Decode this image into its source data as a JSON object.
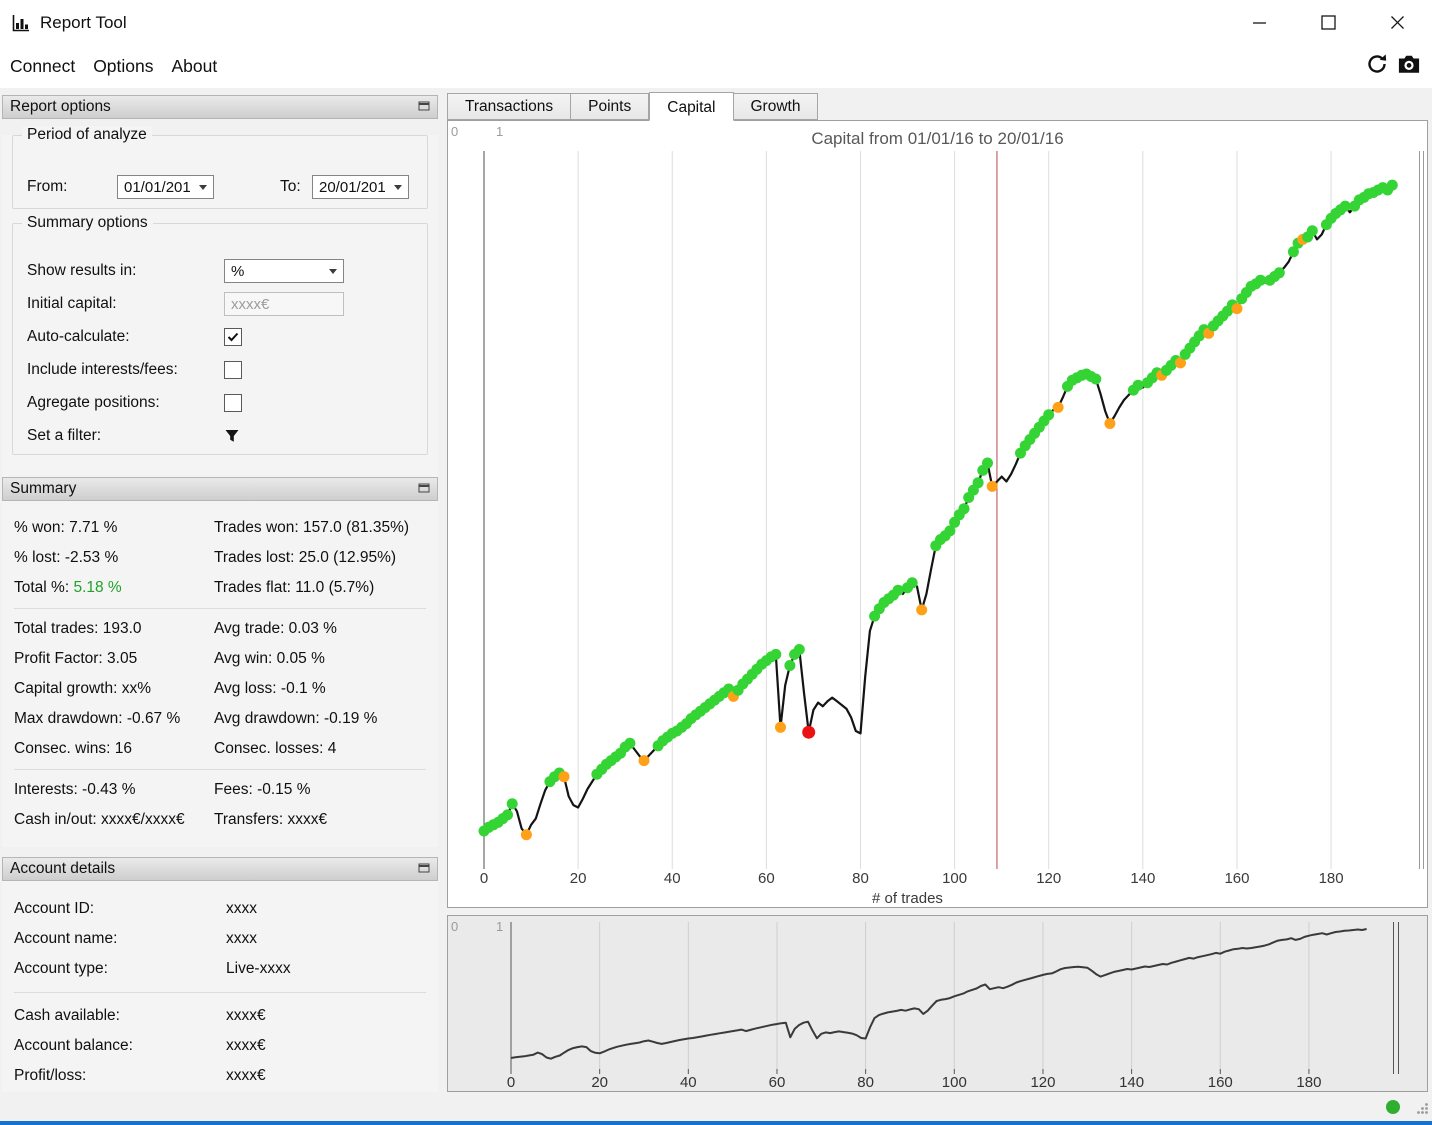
{
  "window": {
    "title": "Report Tool"
  },
  "menu": {
    "items": [
      "Connect",
      "Options",
      "About"
    ]
  },
  "report_options": {
    "header": "Report options",
    "period": {
      "title": "Period of analyze",
      "from_label": "From:",
      "from_value": "01/01/201",
      "to_label": "To:",
      "to_value": "20/01/201"
    },
    "options": {
      "title": "Summary options",
      "show_results_label": "Show results in:",
      "show_results_value": "%",
      "initial_capital_label": "Initial capital:",
      "initial_capital_value": "xxxx€",
      "auto_calculate_label": "Auto-calculate:",
      "auto_calculate_checked": true,
      "include_fees_label": "Include interests/fees:",
      "include_fees_checked": false,
      "aggregate_label": "Agregate positions:",
      "aggregate_checked": false,
      "filter_label": "Set a filter:"
    }
  },
  "summary": {
    "header": "Summary",
    "rows1": [
      {
        "l": "% won: 7.71 %",
        "r": "Trades won: 157.0 (81.35%)"
      },
      {
        "l": "% lost: -2.53 %",
        "r": "Trades lost: 25.0 (12.95%)"
      }
    ],
    "total": {
      "label": "Total %:",
      "value": "5.18 %",
      "right": "Trades flat: 11.0 (5.7%)"
    },
    "total_color": "#1fa32a",
    "rows2": [
      {
        "l": "Total trades: 193.0",
        "r": "Avg trade: 0.03 %"
      },
      {
        "l": "Profit Factor: 3.05",
        "r": "Avg win: 0.05 %"
      },
      {
        "l": "Capital growth: xx%",
        "r": "Avg loss: -0.1 %"
      },
      {
        "l": "Max drawdown: -0.67 %",
        "r": "Avg drawdown: -0.19 %"
      },
      {
        "l": "Consec. wins: 16",
        "r": "Consec. losses: 4"
      }
    ],
    "rows3": [
      {
        "l": "Interests: -0.43 %",
        "r": "Fees: -0.15 %"
      },
      {
        "l": "Cash in/out: xxxx€/xxxx€",
        "r": "Transfers: xxxx€"
      }
    ]
  },
  "account": {
    "header": "Account details",
    "rows1": [
      {
        "l": "Account ID:",
        "v": "xxxx"
      },
      {
        "l": "Account name:",
        "v": "xxxx"
      },
      {
        "l": "Account type:",
        "v": "Live-xxxx"
      }
    ],
    "rows2": [
      {
        "l": "Cash available:",
        "v": "xxxx€"
      },
      {
        "l": "Account balance:",
        "v": "xxxx€"
      },
      {
        "l": "Profit/loss:",
        "v": "xxxx€"
      }
    ]
  },
  "tabs": [
    {
      "label": "Transactions",
      "active": false
    },
    {
      "label": "Points",
      "active": false
    },
    {
      "label": "Capital",
      "active": true
    },
    {
      "label": "Growth",
      "active": false
    }
  ],
  "chart_data": {
    "type": "line",
    "title": "Capital from 01/01/16 to 20/01/16",
    "xlabel": "# of trades",
    "x_ticks": [
      0,
      20,
      40,
      60,
      80,
      100,
      120,
      140,
      160,
      180
    ],
    "xlim": [
      -8,
      200
    ],
    "ylim_pct": [
      -0.4,
      5.6
    ],
    "grid": "vertical",
    "axis_fragments": [
      "0",
      "1"
    ],
    "line_color": "#141414",
    "marker_colors": {
      "g": "#35d435",
      "o": "#ffa019",
      "r": "#ea1212"
    },
    "vline_x": 109,
    "vline_color": "#b5494c",
    "series": [
      {
        "name": "Capital (%)",
        "points": [
          [
            0,
            0.0,
            "g"
          ],
          [
            1,
            0.03,
            "g"
          ],
          [
            2,
            0.05,
            "g"
          ],
          [
            3,
            0.07,
            "g"
          ],
          [
            4,
            0.1,
            "g"
          ],
          [
            5,
            0.13,
            "g"
          ],
          [
            6,
            0.22,
            "g"
          ],
          [
            7,
            0.16,
            ""
          ],
          [
            8,
            0.02,
            ""
          ],
          [
            9,
            -0.03,
            "o"
          ],
          [
            10,
            0.05,
            ""
          ],
          [
            11,
            0.1,
            ""
          ],
          [
            12,
            0.22,
            ""
          ],
          [
            13,
            0.33,
            ""
          ],
          [
            14,
            0.4,
            "g"
          ],
          [
            15,
            0.44,
            "g"
          ],
          [
            16,
            0.47,
            "g"
          ],
          [
            17,
            0.44,
            "o"
          ],
          [
            18,
            0.28,
            ""
          ],
          [
            19,
            0.21,
            ""
          ],
          [
            20,
            0.19,
            ""
          ],
          [
            21,
            0.26,
            ""
          ],
          [
            22,
            0.34,
            ""
          ],
          [
            23,
            0.4,
            ""
          ],
          [
            24,
            0.46,
            "g"
          ],
          [
            25,
            0.5,
            "g"
          ],
          [
            26,
            0.54,
            "g"
          ],
          [
            27,
            0.57,
            "g"
          ],
          [
            28,
            0.6,
            "g"
          ],
          [
            29,
            0.63,
            "g"
          ],
          [
            30,
            0.68,
            "g"
          ],
          [
            31,
            0.71,
            "g"
          ],
          [
            32,
            0.66,
            ""
          ],
          [
            33,
            0.61,
            ""
          ],
          [
            34,
            0.57,
            "o"
          ],
          [
            35,
            0.61,
            ""
          ],
          [
            36,
            0.65,
            ""
          ],
          [
            37,
            0.69,
            "g"
          ],
          [
            38,
            0.73,
            "g"
          ],
          [
            39,
            0.76,
            "g"
          ],
          [
            40,
            0.79,
            "g"
          ],
          [
            41,
            0.81,
            "g"
          ],
          [
            42,
            0.84,
            "g"
          ],
          [
            43,
            0.87,
            "g"
          ],
          [
            44,
            0.91,
            "g"
          ],
          [
            45,
            0.94,
            "g"
          ],
          [
            46,
            0.97,
            "g"
          ],
          [
            47,
            1.0,
            "g"
          ],
          [
            48,
            1.03,
            "g"
          ],
          [
            49,
            1.06,
            "g"
          ],
          [
            50,
            1.09,
            "g"
          ],
          [
            51,
            1.12,
            "g"
          ],
          [
            52,
            1.15,
            "g"
          ],
          [
            53,
            1.09,
            "o"
          ],
          [
            54,
            1.14,
            "g"
          ],
          [
            55,
            1.19,
            "g"
          ],
          [
            56,
            1.23,
            "g"
          ],
          [
            57,
            1.27,
            "g"
          ],
          [
            58,
            1.31,
            "g"
          ],
          [
            59,
            1.35,
            "g"
          ],
          [
            60,
            1.38,
            "g"
          ],
          [
            61,
            1.41,
            "g"
          ],
          [
            62,
            1.43,
            "g"
          ],
          [
            63,
            0.84,
            "o"
          ],
          [
            64,
            1.18,
            ""
          ],
          [
            65,
            1.34,
            "g"
          ],
          [
            66,
            1.43,
            "g"
          ],
          [
            67,
            1.47,
            "g"
          ],
          [
            68,
            1.12,
            ""
          ],
          [
            69,
            0.8,
            "r"
          ],
          [
            70,
            0.98,
            ""
          ],
          [
            71,
            1.04,
            ""
          ],
          [
            72,
            1.01,
            ""
          ],
          [
            73,
            1.05,
            ""
          ],
          [
            74,
            1.08,
            ""
          ],
          [
            75,
            1.05,
            ""
          ],
          [
            76,
            1.02,
            ""
          ],
          [
            77,
            0.99,
            ""
          ],
          [
            78,
            0.92,
            ""
          ],
          [
            79,
            0.81,
            ""
          ],
          [
            80,
            0.79,
            ""
          ],
          [
            81,
            1.25,
            ""
          ],
          [
            82,
            1.62,
            ""
          ],
          [
            83,
            1.74,
            "g"
          ],
          [
            84,
            1.8,
            "g"
          ],
          [
            85,
            1.85,
            "g"
          ],
          [
            86,
            1.88,
            "g"
          ],
          [
            87,
            1.91,
            "g"
          ],
          [
            88,
            1.95,
            "g"
          ],
          [
            89,
            1.92,
            ""
          ],
          [
            90,
            1.97,
            "g"
          ],
          [
            91,
            2.01,
            "g"
          ],
          [
            92,
            1.98,
            ""
          ],
          [
            93,
            1.79,
            "o"
          ],
          [
            94,
            1.92,
            ""
          ],
          [
            95,
            2.12,
            ""
          ],
          [
            96,
            2.31,
            "g"
          ],
          [
            97,
            2.36,
            "g"
          ],
          [
            98,
            2.39,
            "g"
          ],
          [
            99,
            2.43,
            "g"
          ],
          [
            100,
            2.5,
            "g"
          ],
          [
            101,
            2.56,
            "g"
          ],
          [
            102,
            2.61,
            "g"
          ],
          [
            103,
            2.7,
            "g"
          ],
          [
            104,
            2.76,
            "g"
          ],
          [
            105,
            2.82,
            "g"
          ],
          [
            106,
            2.92,
            "g"
          ],
          [
            107,
            2.98,
            "g"
          ],
          [
            108,
            2.79,
            "o"
          ],
          [
            109,
            2.83,
            ""
          ],
          [
            110,
            2.87,
            ""
          ],
          [
            111,
            2.83,
            ""
          ],
          [
            112,
            2.89,
            ""
          ],
          [
            113,
            2.97,
            ""
          ],
          [
            114,
            3.06,
            "g"
          ],
          [
            115,
            3.12,
            "g"
          ],
          [
            116,
            3.17,
            "g"
          ],
          [
            117,
            3.22,
            "g"
          ],
          [
            118,
            3.27,
            "g"
          ],
          [
            119,
            3.32,
            "g"
          ],
          [
            120,
            3.37,
            "g"
          ],
          [
            121,
            3.41,
            ""
          ],
          [
            122,
            3.43,
            "o"
          ],
          [
            123,
            3.51,
            ""
          ],
          [
            124,
            3.6,
            "g"
          ],
          [
            125,
            3.65,
            "g"
          ],
          [
            126,
            3.67,
            "g"
          ],
          [
            127,
            3.69,
            "g"
          ],
          [
            128,
            3.7,
            "g"
          ],
          [
            129,
            3.68,
            "g"
          ],
          [
            130,
            3.66,
            "g"
          ],
          [
            131,
            3.54,
            ""
          ],
          [
            132,
            3.4,
            ""
          ],
          [
            133,
            3.3,
            "o"
          ],
          [
            134,
            3.36,
            ""
          ],
          [
            135,
            3.43,
            ""
          ],
          [
            136,
            3.49,
            ""
          ],
          [
            137,
            3.53,
            ""
          ],
          [
            138,
            3.57,
            "g"
          ],
          [
            139,
            3.61,
            "g"
          ],
          [
            140,
            3.59,
            ""
          ],
          [
            141,
            3.63,
            "g"
          ],
          [
            142,
            3.67,
            "g"
          ],
          [
            143,
            3.71,
            "g"
          ],
          [
            144,
            3.69,
            "o"
          ],
          [
            145,
            3.73,
            "g"
          ],
          [
            146,
            3.77,
            "g"
          ],
          [
            147,
            3.81,
            "g"
          ],
          [
            148,
            3.79,
            "o"
          ],
          [
            149,
            3.86,
            "g"
          ],
          [
            150,
            3.91,
            "g"
          ],
          [
            151,
            3.96,
            "g"
          ],
          [
            152,
            4.01,
            "g"
          ],
          [
            153,
            4.06,
            "g"
          ],
          [
            154,
            4.03,
            "o"
          ],
          [
            155,
            4.09,
            "g"
          ],
          [
            156,
            4.13,
            "g"
          ],
          [
            157,
            4.17,
            "g"
          ],
          [
            158,
            4.21,
            "g"
          ],
          [
            159,
            4.26,
            "g"
          ],
          [
            160,
            4.23,
            "o"
          ],
          [
            161,
            4.31,
            "g"
          ],
          [
            162,
            4.36,
            "g"
          ],
          [
            163,
            4.41,
            "g"
          ],
          [
            164,
            4.43,
            "g"
          ],
          [
            165,
            4.46,
            "g"
          ],
          [
            166,
            4.44,
            ""
          ],
          [
            167,
            4.46,
            "g"
          ],
          [
            168,
            4.49,
            "g"
          ],
          [
            169,
            4.52,
            "g"
          ],
          [
            170,
            4.56,
            ""
          ],
          [
            171,
            4.61,
            ""
          ],
          [
            172,
            4.69,
            "g"
          ],
          [
            173,
            4.76,
            "g"
          ],
          [
            174,
            4.79,
            "o"
          ],
          [
            175,
            4.81,
            "g"
          ],
          [
            176,
            4.86,
            "g"
          ],
          [
            177,
            4.79,
            ""
          ],
          [
            178,
            4.83,
            ""
          ],
          [
            179,
            4.91,
            "g"
          ],
          [
            180,
            4.96,
            "g"
          ],
          [
            181,
            5.0,
            "g"
          ],
          [
            182,
            5.03,
            "g"
          ],
          [
            183,
            5.06,
            "g"
          ],
          [
            184,
            5.01,
            ""
          ],
          [
            185,
            5.06,
            "g"
          ],
          [
            186,
            5.11,
            "g"
          ],
          [
            187,
            5.13,
            "g"
          ],
          [
            188,
            5.16,
            "g"
          ],
          [
            189,
            5.17,
            "g"
          ],
          [
            190,
            5.19,
            "g"
          ],
          [
            191,
            5.21,
            "g"
          ],
          [
            192,
            5.19,
            "g"
          ],
          [
            193,
            5.23,
            "g"
          ]
        ]
      }
    ],
    "overview": {
      "x_ticks": [
        0,
        20,
        40,
        60,
        80,
        100,
        120,
        140,
        160,
        180
      ],
      "line_color": "#3a3a3a",
      "axis_fragments": [
        "0",
        "1"
      ]
    }
  },
  "statusbar": {
    "connection_dot_color": "#2fae2f"
  }
}
